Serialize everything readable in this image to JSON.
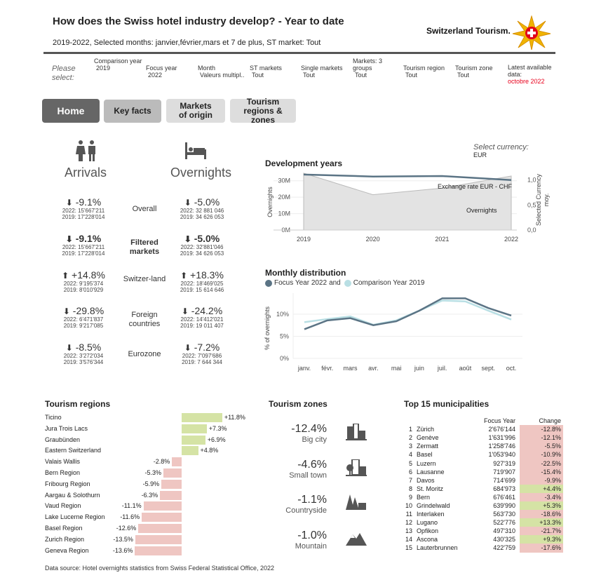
{
  "header": {
    "title": "How does the Swiss hotel industry develop? - Year to date",
    "subtitle_prefix": "2019-2022, Selected months: janvier,février,mars et 7 de plus, ST market: ",
    "subtitle_market": "Tout",
    "logo_text": "Switzerland Tourism."
  },
  "filters": {
    "please_select": "Please select:",
    "items": [
      {
        "label": "Comparison year",
        "value": "2019"
      },
      {
        "label": "Focus year",
        "value": "2022"
      },
      {
        "label": "Month",
        "value": "Valeurs multipl.."
      },
      {
        "label": "ST markets",
        "value": "Tout"
      },
      {
        "label": "Single markets",
        "value": "Tout"
      },
      {
        "label": "Markets: 3 groups",
        "value": "Tout"
      },
      {
        "label": "Tourism region",
        "value": "Tout"
      },
      {
        "label": "Tourism zone",
        "value": "Tout"
      }
    ],
    "latest_label": "Latest available data:",
    "latest_value": "octobre 2022",
    "latest_color": "#e8001c"
  },
  "nav": {
    "home": "Home",
    "key_facts": "Key facts",
    "markets": "Markets of origin",
    "regions": "Tourism regions & zones"
  },
  "kpis": {
    "arrivals": "Arrivals",
    "overnights": "Overnights",
    "rows": [
      {
        "label": "Overall",
        "bold": false,
        "arr": {
          "dir": "down",
          "pct": "-9.1%",
          "l1": "2022: 15'667'211",
          "l2": "2019: 17'228'014"
        },
        "ovn": {
          "dir": "down",
          "pct": "-5.0%",
          "l1": "2022: 32 881 046",
          "l2": "2019: 34 626 053"
        }
      },
      {
        "label": "Filtered markets",
        "bold": true,
        "arr": {
          "dir": "down",
          "pct": "-9.1%",
          "l1": "2022: 15'667'211",
          "l2": "2019: 17'228'014"
        },
        "ovn": {
          "dir": "down",
          "pct": "-5.0%",
          "l1": "2022: 32'881'046",
          "l2": "2019: 34 626 053"
        }
      },
      {
        "label": "Switzer-land",
        "bold": false,
        "arr": {
          "dir": "up",
          "pct": "+14.8%",
          "l1": "2022: 9'195'374",
          "l2": "2019: 8'010'929"
        },
        "ovn": {
          "dir": "up",
          "pct": "+18.3%",
          "l1": "2022: 18'469'025",
          "l2": "2019: 15 614 646"
        }
      },
      {
        "label": "Foreign countries",
        "bold": false,
        "arr": {
          "dir": "down",
          "pct": "-29.8%",
          "l1": "2022: 6'471'837",
          "l2": "2019: 9'217'085"
        },
        "ovn": {
          "dir": "down",
          "pct": "-24.2%",
          "l1": "2022: 14'412'021",
          "l2": "2019: 19 011 407"
        }
      },
      {
        "label": "Eurozone",
        "bold": false,
        "arr": {
          "dir": "down",
          "pct": "-8.5%",
          "l1": "2022: 3'272'034",
          "l2": "2019: 3'576'344"
        },
        "ovn": {
          "dir": "down",
          "pct": "-7.2%",
          "l1": "2022: 7'097'686",
          "l2": "2019: 7 644 344"
        }
      }
    ]
  },
  "currency": {
    "label": "Select currency:",
    "value": "EUR"
  },
  "chart_data": [
    {
      "type": "area",
      "title": "Development years",
      "x": [
        2019,
        2020,
        2021,
        2022
      ],
      "series": [
        {
          "name": "Overnights",
          "axis": "left",
          "values": [
            34626053,
            21500000,
            25500000,
            32881046
          ],
          "color": "#e3e3e3"
        },
        {
          "name": "Exchange rate EUR - CHF",
          "axis": "right",
          "values": [
            1.11,
            1.07,
            1.08,
            1.0
          ],
          "color": "#5b7485"
        }
      ],
      "ylabel": "Overnights",
      "y2label": "Selected Currency moy.",
      "yticks": [
        "0M",
        "10M",
        "20M",
        "30M"
      ],
      "ylim": [
        0,
        35000000
      ],
      "y2ticks": [
        "0,0",
        "0,5",
        "1,0"
      ],
      "y2lim": [
        0,
        1.15
      ]
    },
    {
      "type": "line",
      "title": "Monthly distribution",
      "ylabel": "% of overnights",
      "categories": [
        "janv.",
        "févr.",
        "mars",
        "avr.",
        "mai",
        "juin",
        "juil.",
        "août",
        "sept.",
        "oct."
      ],
      "legend_joiner": "and",
      "yticks": [
        "0%",
        "5%",
        "10%"
      ],
      "ylim": [
        0,
        14.5
      ],
      "series": [
        {
          "name": "Focus Year 2022",
          "color": "#5b7485",
          "values": [
            6.6,
            8.6,
            9.1,
            7.5,
            8.4,
            10.8,
            13.6,
            13.6,
            11.4,
            9.7
          ]
        },
        {
          "name": "Comparison Year 2019",
          "color": "#b9dfe4",
          "values": [
            8.2,
            8.9,
            9.5,
            7.6,
            8.6,
            10.8,
            13.1,
            12.9,
            10.8,
            8.8
          ]
        }
      ]
    }
  ],
  "regions": {
    "title": "Tourism regions",
    "pos_color": "#d5e3a5",
    "neg_color": "#efc6c2",
    "items": [
      {
        "name": "Ticino",
        "value": 11.8,
        "label": "+11.8%"
      },
      {
        "name": "Jura Trois Lacs",
        "value": 7.3,
        "label": "+7.3%"
      },
      {
        "name": "Graubünden",
        "value": 6.9,
        "label": "+6.9%"
      },
      {
        "name": "Eastern Switzerland",
        "value": 4.8,
        "label": "+4.8%"
      },
      {
        "name": "Valais Wallis",
        "value": -2.8,
        "label": "-2.8%"
      },
      {
        "name": "Bern Region",
        "value": -5.3,
        "label": "-5.3%"
      },
      {
        "name": "Fribourg Region",
        "value": -5.9,
        "label": "-5.9%"
      },
      {
        "name": "Aargau & Solothurn",
        "value": -6.3,
        "label": "-6.3%"
      },
      {
        "name": "Vaud Region",
        "value": -11.1,
        "label": "-11.1%"
      },
      {
        "name": "Lake Lucerne Region",
        "value": -11.6,
        "label": "-11.6%"
      },
      {
        "name": "Basel Region",
        "value": -12.6,
        "label": "-12.6%"
      },
      {
        "name": "Zurich Region",
        "value": -13.5,
        "label": "-13.5%"
      },
      {
        "name": "Geneva Region",
        "value": -13.6,
        "label": "-13.6%"
      }
    ]
  },
  "zones": {
    "title": "Tourism zones",
    "items": [
      {
        "pct": "-12.4%",
        "name": "Big city",
        "icon": "big-city-icon"
      },
      {
        "pct": "-4.6%",
        "name": "Small town",
        "icon": "small-town-icon"
      },
      {
        "pct": "-1.1%",
        "name": "Countryside",
        "icon": "countryside-icon"
      },
      {
        "pct": "-1.0%",
        "name": "Mountain",
        "icon": "mountain-icon"
      }
    ]
  },
  "municipalities": {
    "title": "Top 15 municipalities",
    "col_focus": "Focus Year",
    "col_change": "Change",
    "rows": [
      {
        "rank": "1",
        "name": "Zürich",
        "focus": "2'676'144",
        "change": "-12.8%",
        "pos": false
      },
      {
        "rank": "2",
        "name": "Genève",
        "focus": "1'631'996",
        "change": "-12.1%",
        "pos": false
      },
      {
        "rank": "3",
        "name": "Zermatt",
        "focus": "1'258'746",
        "change": "-5.5%",
        "pos": false
      },
      {
        "rank": "4",
        "name": "Basel",
        "focus": "1'053'940",
        "change": "-10.9%",
        "pos": false
      },
      {
        "rank": "5",
        "name": "Luzern",
        "focus": "927'319",
        "change": "-22.5%",
        "pos": false
      },
      {
        "rank": "6",
        "name": "Lausanne",
        "focus": "719'907",
        "change": "-15.4%",
        "pos": false
      },
      {
        "rank": "7",
        "name": "Davos",
        "focus": "714'699",
        "change": "-9.9%",
        "pos": false
      },
      {
        "rank": "8",
        "name": "St. Moritz",
        "focus": "684'973",
        "change": "+4.4%",
        "pos": true
      },
      {
        "rank": "9",
        "name": "Bern",
        "focus": "676'461",
        "change": "-3.4%",
        "pos": false
      },
      {
        "rank": "10",
        "name": "Grindelwald",
        "focus": "639'990",
        "change": "+5.3%",
        "pos": true
      },
      {
        "rank": "11",
        "name": "Interlaken",
        "focus": "563'730",
        "change": "-18.6%",
        "pos": false
      },
      {
        "rank": "12",
        "name": "Lugano",
        "focus": "522'776",
        "change": "+13.3%",
        "pos": true
      },
      {
        "rank": "13",
        "name": "Opfikon",
        "focus": "497'310",
        "change": "-21.7%",
        "pos": false
      },
      {
        "rank": "14",
        "name": "Ascona",
        "focus": "430'325",
        "change": "+9.3%",
        "pos": true
      },
      {
        "rank": "15",
        "name": "Lauterbrunnen",
        "focus": "422'759",
        "change": "-17.6%",
        "pos": false
      }
    ]
  },
  "footer": {
    "source": "Data source: Hotel overnights statistics from Swiss Federal Statistical Office, 2022"
  }
}
